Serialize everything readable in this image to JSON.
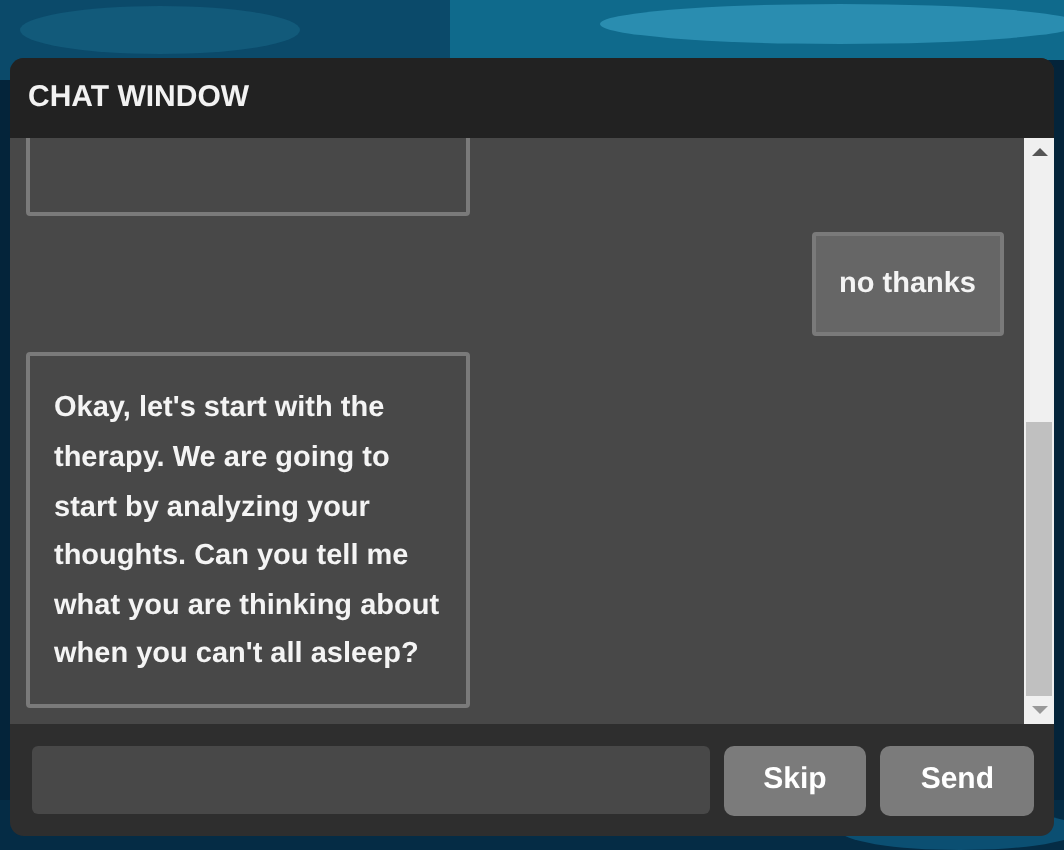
{
  "window": {
    "title": "CHAT WINDOW"
  },
  "messages": [
    {
      "kind": "bot"
    },
    {
      "kind": "user",
      "text": "no thanks"
    },
    {
      "kind": "bot",
      "text": "Okay, let's start with the therapy. We are going to start by analyzing your thoughts. Can you tell me what you are thinking about when you can't all asleep?"
    }
  ],
  "buttons": [
    {
      "label": "Skip"
    },
    {
      "label": "Send"
    }
  ]
}
